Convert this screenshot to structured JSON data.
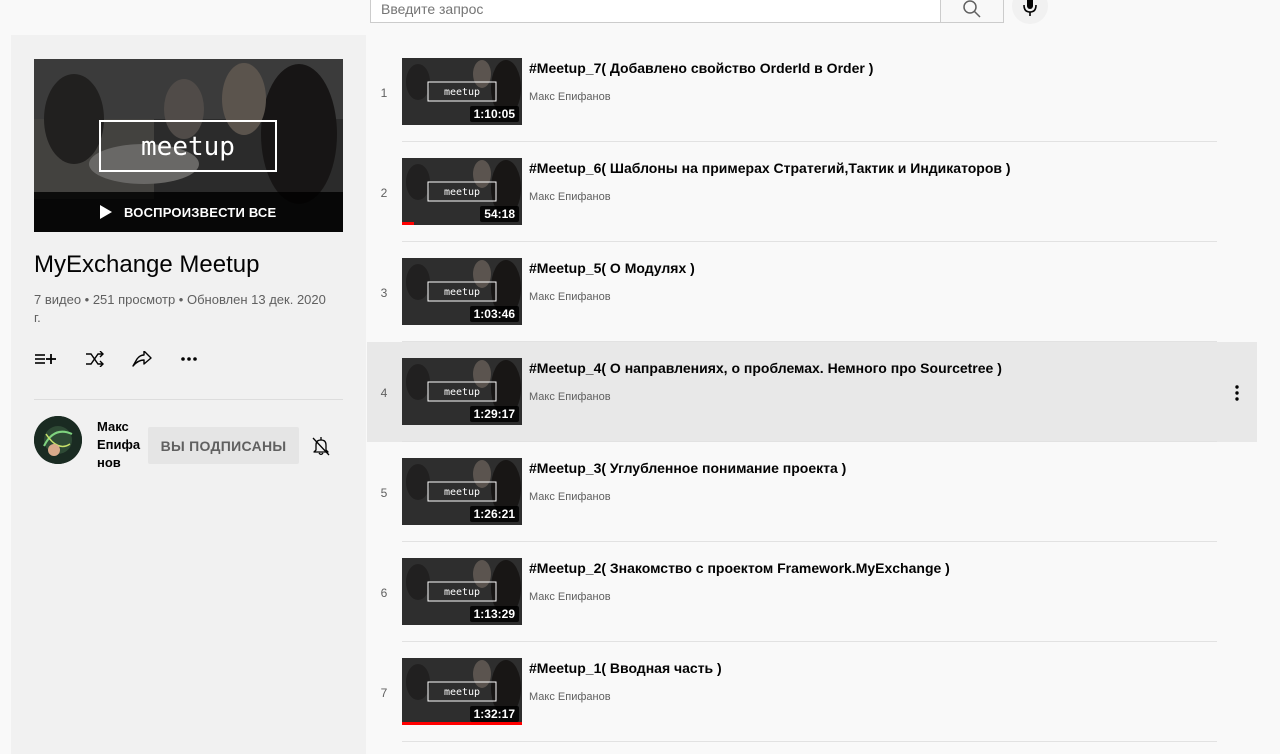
{
  "search": {
    "placeholder": "Введите запрос"
  },
  "playlist": {
    "title": "MyExchange Meetup",
    "stats": "7 видео • 251 просмотр • Обновлен 13 дек. 2020 г.",
    "play_all_label": "ВОСПРОИЗВЕСТИ ВСЕ",
    "hero_text": "meetup"
  },
  "owner": {
    "name": "Макс Епифанов",
    "subscribe_label": "ВЫ ПОДПИСАНЫ"
  },
  "videos": [
    {
      "index": "1",
      "title": "#Meetup_7( Добавлено свойство OrderId в Order )",
      "channel": "Макс Епифанов",
      "duration": "1:10:05",
      "watched_fraction": 0
    },
    {
      "index": "2",
      "title": "#Meetup_6( Шаблоны на примерах Стратегий,Тактик и Индикаторов )",
      "channel": "Макс Епифанов",
      "duration": "54:18",
      "watched_fraction": 0.1
    },
    {
      "index": "3",
      "title": "#Meetup_5( О Модулях )",
      "channel": "Макс Епифанов",
      "duration": "1:03:46",
      "watched_fraction": 0
    },
    {
      "index": "4",
      "title": "#Meetup_4( О направлениях, о проблемах. Немного про Sourcetree )",
      "channel": "Макс Епифанов",
      "duration": "1:29:17",
      "watched_fraction": 0
    },
    {
      "index": "5",
      "title": "#Meetup_3( Углубленное понимание проекта )",
      "channel": "Макс Епифанов",
      "duration": "1:26:21",
      "watched_fraction": 0
    },
    {
      "index": "6",
      "title": "#Meetup_2( Знакомство с проектом Framework.MyExchange )",
      "channel": "Макс Епифанов",
      "duration": "1:13:29",
      "watched_fraction": 0
    },
    {
      "index": "7",
      "title": "#Meetup_1( Вводная часть )",
      "channel": "Макс Епифанов",
      "duration": "1:32:17",
      "watched_fraction": 1
    }
  ],
  "colors": {
    "progress": "#ff0000",
    "sidebar_bg": "#f1f1f1",
    "hover_row_bg": "#e8e8e8"
  }
}
